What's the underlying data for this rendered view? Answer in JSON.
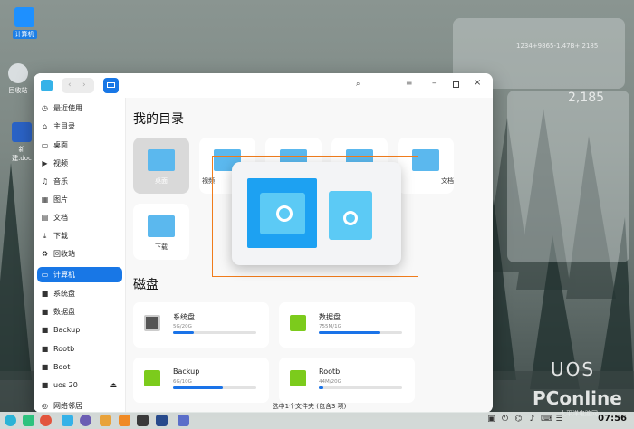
{
  "desktop": {
    "icons": [
      {
        "label": "计算机"
      },
      {
        "label": "回收站"
      },
      {
        "label": "新建.doc"
      }
    ],
    "widget": {
      "expression": "1234+9865-1.47B+ 2185",
      "result": "2,185"
    },
    "watermarks": {
      "os": "UOS",
      "site": "PConline",
      "site_sub": "太平洋电脑网"
    }
  },
  "window": {
    "search_icon": "search-icon",
    "sidebar": [
      {
        "label": "最近使用",
        "icon": "clock-icon"
      },
      {
        "label": "主目录",
        "icon": "home-icon"
      },
      {
        "label": "桌面",
        "icon": "desktop-icon"
      },
      {
        "label": "视频",
        "icon": "video-icon"
      },
      {
        "label": "音乐",
        "icon": "music-icon"
      },
      {
        "label": "图片",
        "icon": "image-icon"
      },
      {
        "label": "文档",
        "icon": "document-icon"
      },
      {
        "label": "下载",
        "icon": "download-icon"
      },
      {
        "label": "回收站",
        "icon": "trash-icon"
      },
      {
        "label": "计算机",
        "icon": "computer-icon"
      },
      {
        "label": "系统盘",
        "icon": "disk-icon"
      },
      {
        "label": "数据盘",
        "icon": "disk-icon"
      },
      {
        "label": "Backup",
        "icon": "disk-icon"
      },
      {
        "label": "Rootb",
        "icon": "disk-icon"
      },
      {
        "label": "Boot",
        "icon": "disk-icon"
      },
      {
        "label": "uos 20",
        "icon": "disk-icon"
      },
      {
        "label": "网络邻居",
        "icon": "network-icon"
      }
    ],
    "section_home": "我的目录",
    "folders": [
      {
        "label": "桌面",
        "selected": true
      },
      {
        "label": "视频"
      },
      {
        "label": ""
      },
      {
        "label": ""
      },
      {
        "label": "文档"
      },
      {
        "label": "下载"
      }
    ],
    "section_disks": "磁盘",
    "disks": [
      {
        "name": "系统盘",
        "size": "5G/20G",
        "used": 0.25
      },
      {
        "name": "数据盘",
        "size": "755M/1G",
        "used": 0.74
      },
      {
        "name": "Backup",
        "size": "6G/10G",
        "used": 0.6
      },
      {
        "name": "Rootb",
        "size": "44M/20G",
        "used": 0.05
      }
    ],
    "status": "选中1个文件夹 (包含3 项)"
  },
  "taskbar": {
    "clock": "07:56"
  },
  "colors": {
    "accent": "#1877e6",
    "folder": "#5bb8ee",
    "highlight": "#f07c1c",
    "disk_green": "#7ccb1c"
  }
}
